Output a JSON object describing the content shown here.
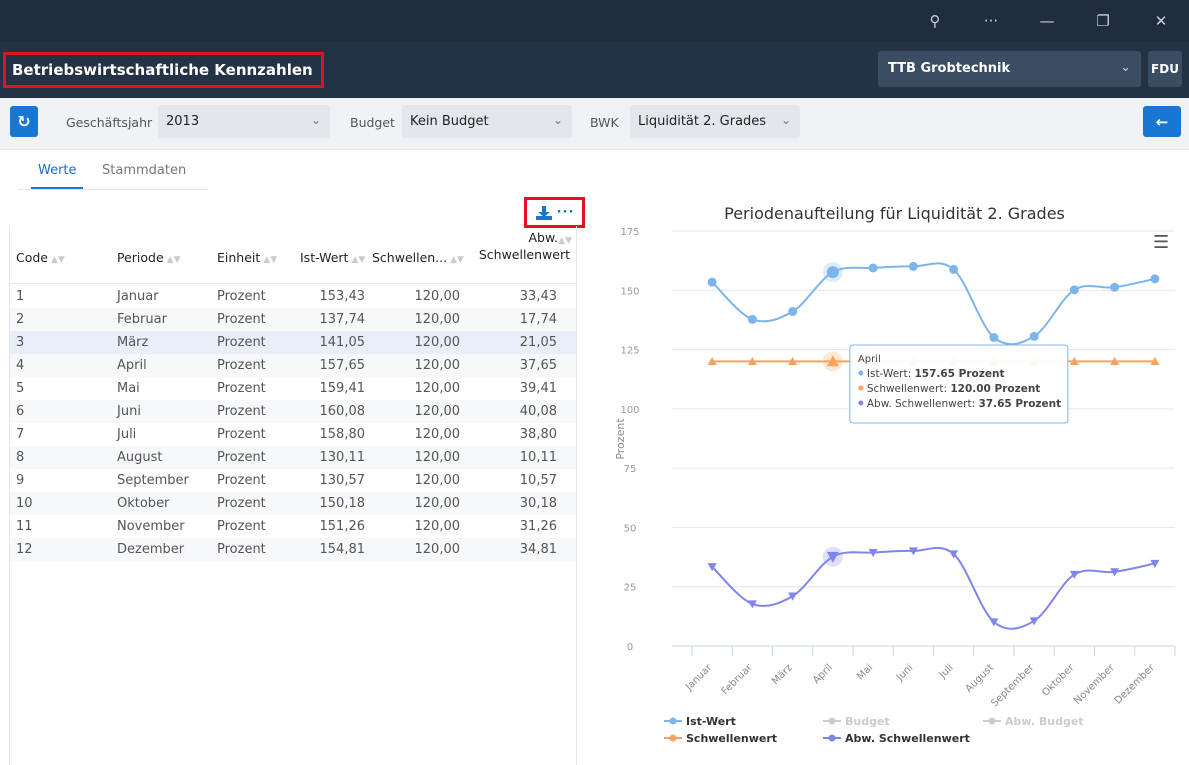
{
  "window": {
    "icons": [
      "zoom-icon",
      "more-icon",
      "minimize-icon",
      "restore-icon",
      "close-icon"
    ],
    "glyphs": [
      "⚲",
      "···",
      "—",
      "❐",
      "✕"
    ]
  },
  "app": {
    "title": "Betriebswirtschaftliche Kennzahlen",
    "company": "TTB Grobtechnik",
    "user": "FDU"
  },
  "filters": {
    "year_label": "Geschäftsjahr",
    "year_value": "2013",
    "budget_label": "Budget",
    "budget_value": "Kein Budget",
    "bwk_label": "BWK",
    "bwk_value": "Liquidität 2. Grades"
  },
  "tabs": [
    "Werte",
    "Stammdaten"
  ],
  "table": {
    "headers": [
      "Code",
      "Periode",
      "Einheit",
      "Ist-Wert",
      "Schwellen...",
      "Abw.",
      "Schwellenwert"
    ],
    "rows": [
      [
        "1",
        "Januar",
        "Prozent",
        "153,43",
        "120,00",
        "33,43"
      ],
      [
        "2",
        "Februar",
        "Prozent",
        "137,74",
        "120,00",
        "17,74"
      ],
      [
        "3",
        "März",
        "Prozent",
        "141,05",
        "120,00",
        "21,05"
      ],
      [
        "4",
        "April",
        "Prozent",
        "157,65",
        "120,00",
        "37,65"
      ],
      [
        "5",
        "Mai",
        "Prozent",
        "159,41",
        "120,00",
        "39,41"
      ],
      [
        "6",
        "Juni",
        "Prozent",
        "160,08",
        "120,00",
        "40,08"
      ],
      [
        "7",
        "Juli",
        "Prozent",
        "158,80",
        "120,00",
        "38,80"
      ],
      [
        "8",
        "August",
        "Prozent",
        "130,11",
        "120,00",
        "10,11"
      ],
      [
        "9",
        "September",
        "Prozent",
        "130,57",
        "120,00",
        "10,57"
      ],
      [
        "10",
        "Oktober",
        "Prozent",
        "150,18",
        "120,00",
        "30,18"
      ],
      [
        "11",
        "November",
        "Prozent",
        "151,26",
        "120,00",
        "31,26"
      ],
      [
        "12",
        "Dezember",
        "Prozent",
        "154,81",
        "120,00",
        "34,81"
      ]
    ],
    "selected_row": 3
  },
  "chart_data": {
    "type": "line",
    "title": "Periodenaufteilung für Liquidität 2. Grades",
    "ylabel": "Prozent",
    "xlabel": "",
    "ylim": [
      0,
      175
    ],
    "yticks": [
      0,
      25,
      50,
      75,
      100,
      125,
      150,
      175
    ],
    "categories": [
      "Januar",
      "Februar",
      "März",
      "April",
      "Mai",
      "Juni",
      "Juli",
      "August",
      "September",
      "Oktober",
      "November",
      "Dezember"
    ],
    "series": [
      {
        "name": "Ist-Wert",
        "color": "#7cb5ec",
        "values": [
          153.43,
          137.74,
          141.05,
          157.65,
          159.41,
          160.08,
          158.8,
          130.11,
          130.57,
          150.18,
          151.26,
          154.81
        ]
      },
      {
        "name": "Schwellenwert",
        "color": "#f7a35c",
        "values": [
          120,
          120,
          120,
          120,
          120,
          120,
          120,
          120,
          120,
          120,
          120,
          120
        ]
      },
      {
        "name": "Abw. Schwellenwert",
        "color": "#8085e9",
        "values": [
          33.43,
          17.74,
          21.05,
          37.65,
          39.41,
          40.08,
          38.8,
          10.11,
          10.57,
          30.18,
          31.26,
          34.81
        ]
      }
    ],
    "legend": [
      {
        "name": "Ist-Wert",
        "color": "#7cb5ec",
        "active": true
      },
      {
        "name": "Budget",
        "color": "#cccccc",
        "active": false
      },
      {
        "name": "Abw. Budget",
        "color": "#cccccc",
        "active": false
      },
      {
        "name": "Schwellenwert",
        "color": "#f7a35c",
        "active": true
      },
      {
        "name": "Abw. Schwellenwert",
        "color": "#8085e9",
        "active": true
      }
    ],
    "legend_position": "bottom",
    "tooltip": {
      "header": "April",
      "lines": [
        {
          "label": "Ist-Wert: ",
          "value": "157.65 Prozent",
          "color": "#7cb5ec"
        },
        {
          "label": "Schwellenwert: ",
          "value": "120.00 Prozent",
          "color": "#f7a35c"
        },
        {
          "label": "Abw. Schwellenwert: ",
          "value": "37.65 Prozent",
          "color": "#8085e9"
        }
      ]
    }
  }
}
